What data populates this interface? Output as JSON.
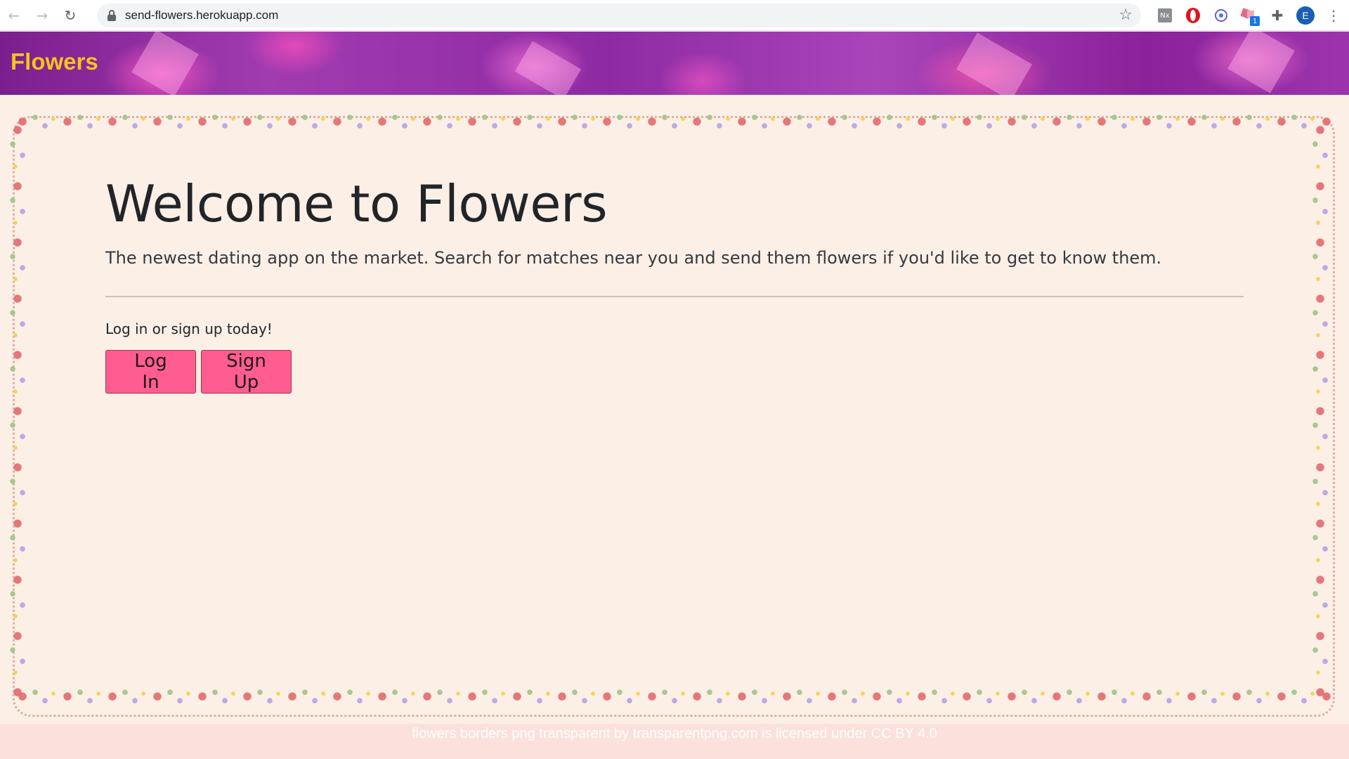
{
  "browser": {
    "url": "send-flowers.herokuapp.com",
    "back_icon": "←",
    "forward_icon": "→",
    "reload_icon": "↻",
    "star_icon": "☆",
    "ext_nx_label": "Nx",
    "ext_badge": "1",
    "puzzle_icon": "✚",
    "profile_initial": "E",
    "menu_icon": "⋮"
  },
  "navbar": {
    "brand": "Flowers",
    "brand_color": "#f5c518"
  },
  "hero": {
    "title": "Welcome to Flowers",
    "lead": "The newest dating app on the market. Search for matches near you and send them flowers if you'd like to get to know them.",
    "prompt": "Log in or sign up today!",
    "login_label": "Log In",
    "signup_label": "Sign Up",
    "button_color": "#ff5d8f"
  },
  "footer": {
    "credit": "flowers borders png transparent by transparentpng.com is licensed under CC BY 4.0"
  }
}
